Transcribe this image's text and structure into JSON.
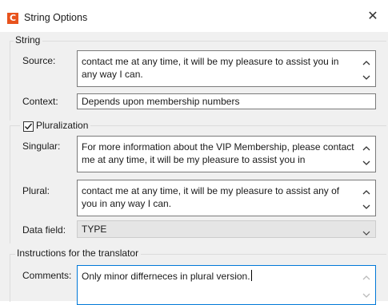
{
  "window": {
    "title": "String Options",
    "app_icon_letter": "C",
    "close_glyph": "✕"
  },
  "string_group": {
    "legend": "String",
    "source_label": "Source:",
    "source_text": "contact me at any time, it will be my pleasure to assist you in any way I can.",
    "context_label": "Context:",
    "context_value": "Depends upon membership numbers"
  },
  "pluralization_group": {
    "legend": "Pluralization",
    "checked": true,
    "singular_label": "Singular:",
    "singular_text": "For more information about the VIP Membership, please contact me at any time, it will be my pleasure to assist you in",
    "plural_label": "Plural:",
    "plural_text": "contact me at any time, it will be my pleasure to assist any of you in any way I can.",
    "data_field_label": "Data field:",
    "data_field_value": "TYPE"
  },
  "instructions_group": {
    "legend": "Instructions for the translator",
    "comments_label": "Comments:",
    "comments_text": "Only minor differneces in plural version."
  },
  "colors": {
    "app_icon": "#e8531d",
    "dialog_bg": "#f0f0f0",
    "active_border": "#0078d7"
  }
}
